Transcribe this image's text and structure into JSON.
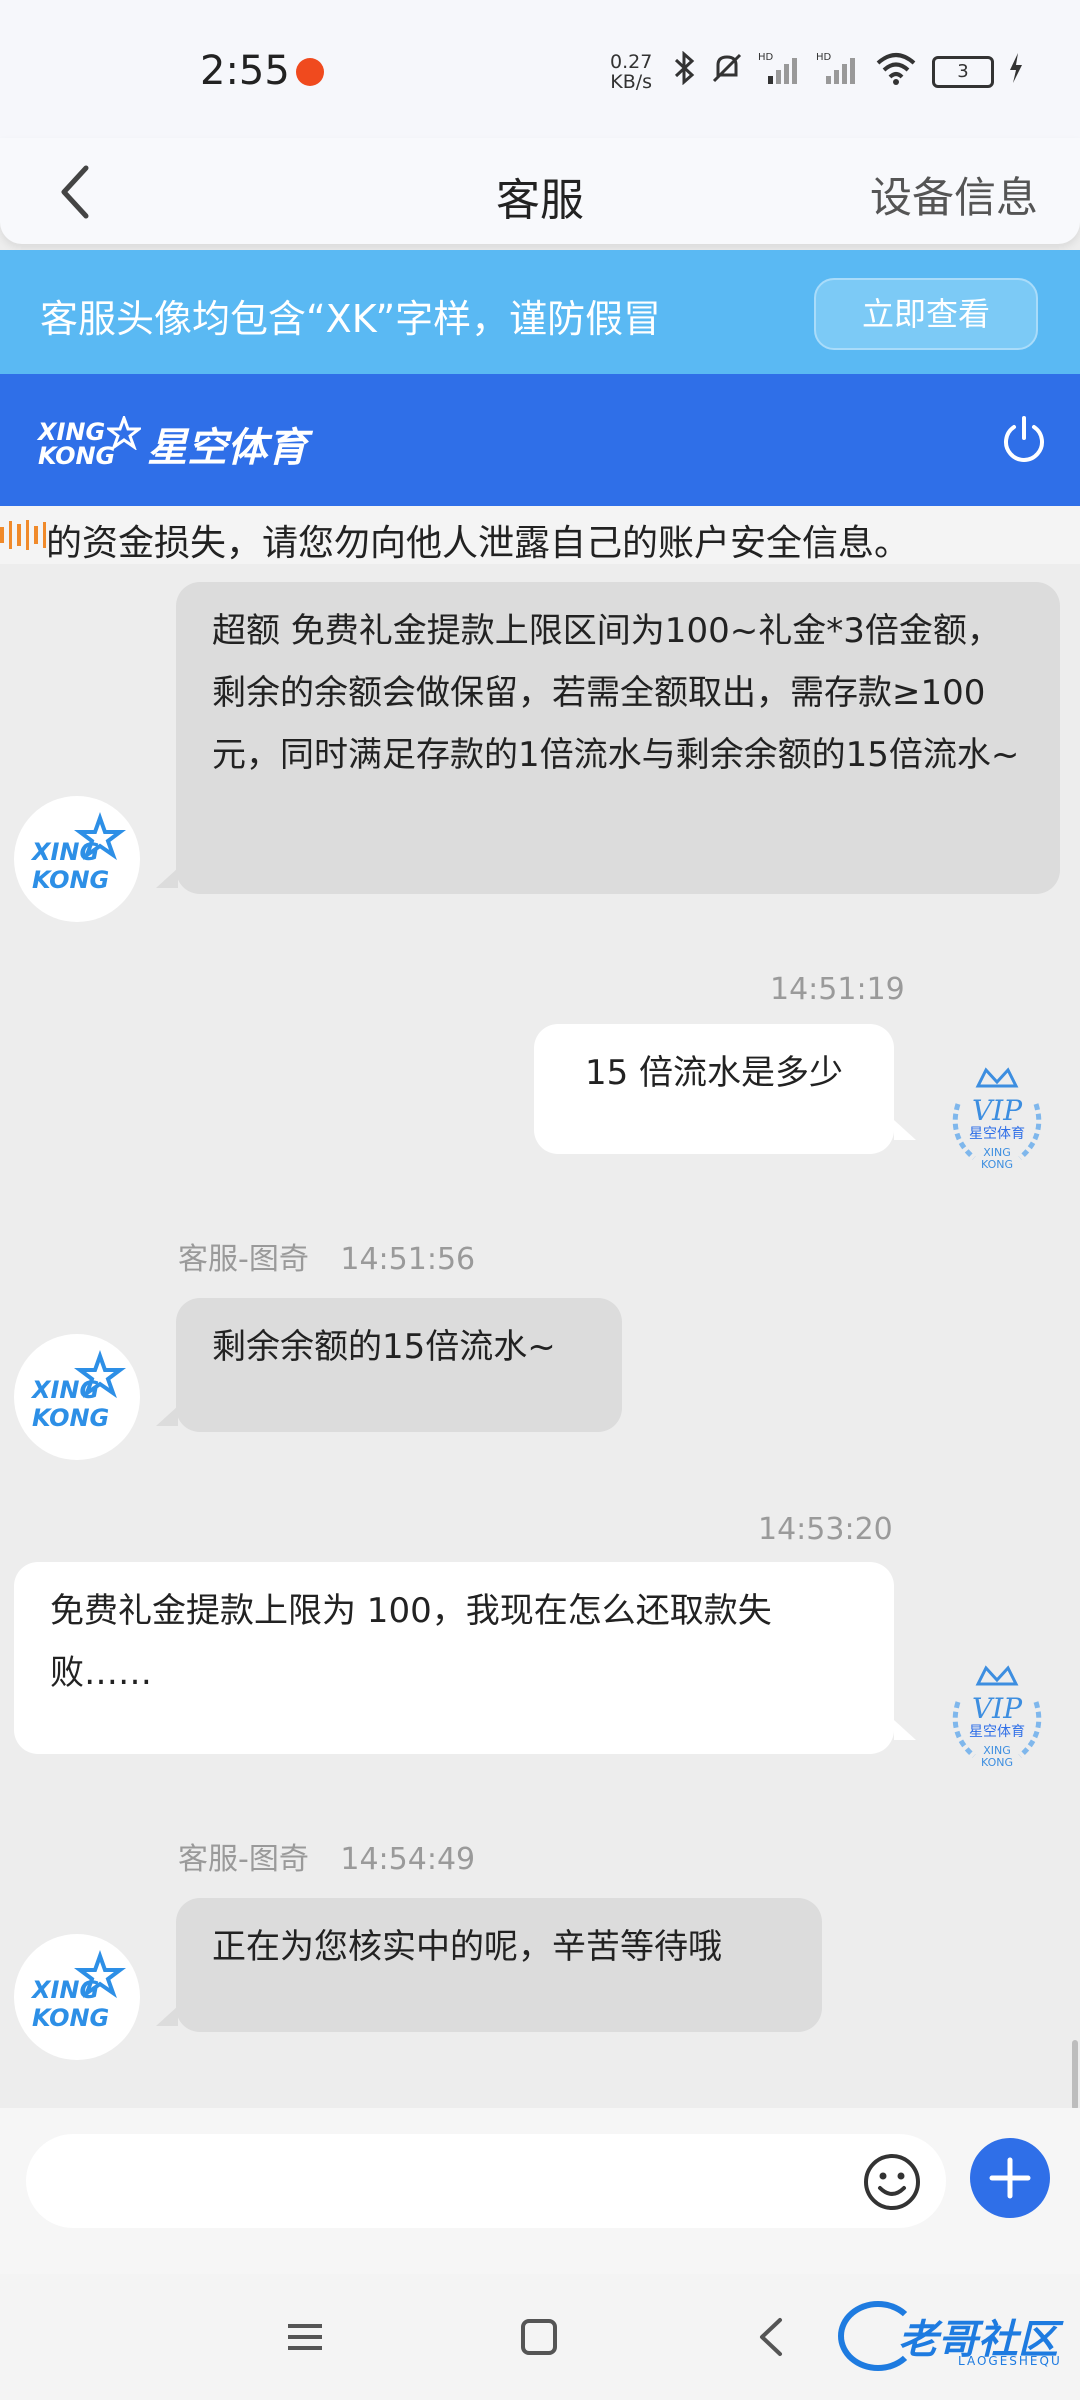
{
  "status_bar": {
    "time": "2:55",
    "net_speed_value": "0.27",
    "net_speed_unit": "KB/s",
    "hd1": "HD",
    "hd2": "HD",
    "battery": "3"
  },
  "header": {
    "title": "客服",
    "device_info": "设备信息"
  },
  "notice": {
    "text": "客服头像均包含“XK”字样，谨防假冒",
    "button": "立即查看"
  },
  "brand": {
    "logo_en_line1": "XING",
    "logo_en_line2": "KONG",
    "logo_cn": "星空体育"
  },
  "marquee": {
    "text": "的资金损失，请您勿向他人泄露自己的账户安全信息。"
  },
  "avatars": {
    "kf_line1": "XING",
    "kf_line2": "KONG",
    "vip_label": "VIP",
    "vip_cn": "星空体育",
    "vip_en1": "XING",
    "vip_en2": "KONG"
  },
  "messages": [
    {
      "side": "left",
      "text": "超额  免费礼金提款上限区间为100~礼金*3倍金额，剩余的余额会做保留，若需全额取出，需存款≥100元，同时满足存款的1倍流水与剩余余额的15倍流水~"
    },
    {
      "side": "right",
      "time": "14:51:19",
      "text": "15 倍流水是多少"
    },
    {
      "side": "left",
      "sender": "客服-图奇",
      "time": "14:51:56",
      "text": "剩余余额的15倍流水~"
    },
    {
      "side": "right",
      "time": "14:53:20",
      "text": "免费礼金提款上限为 100，我现在怎么还取款失败……"
    },
    {
      "side": "left",
      "sender": "客服-图奇",
      "time": "14:54:49",
      "text": "正在为您核实中的呢，辛苦等待哦"
    }
  ],
  "input": {
    "placeholder": ""
  },
  "watermark": {
    "text": "老哥社区",
    "sub": "LAOGESHEQU"
  },
  "colors": {
    "accent_blue": "#2f6fe8",
    "notice_blue": "#5ab9f3",
    "bubble_gray": "#dcdcdc"
  }
}
